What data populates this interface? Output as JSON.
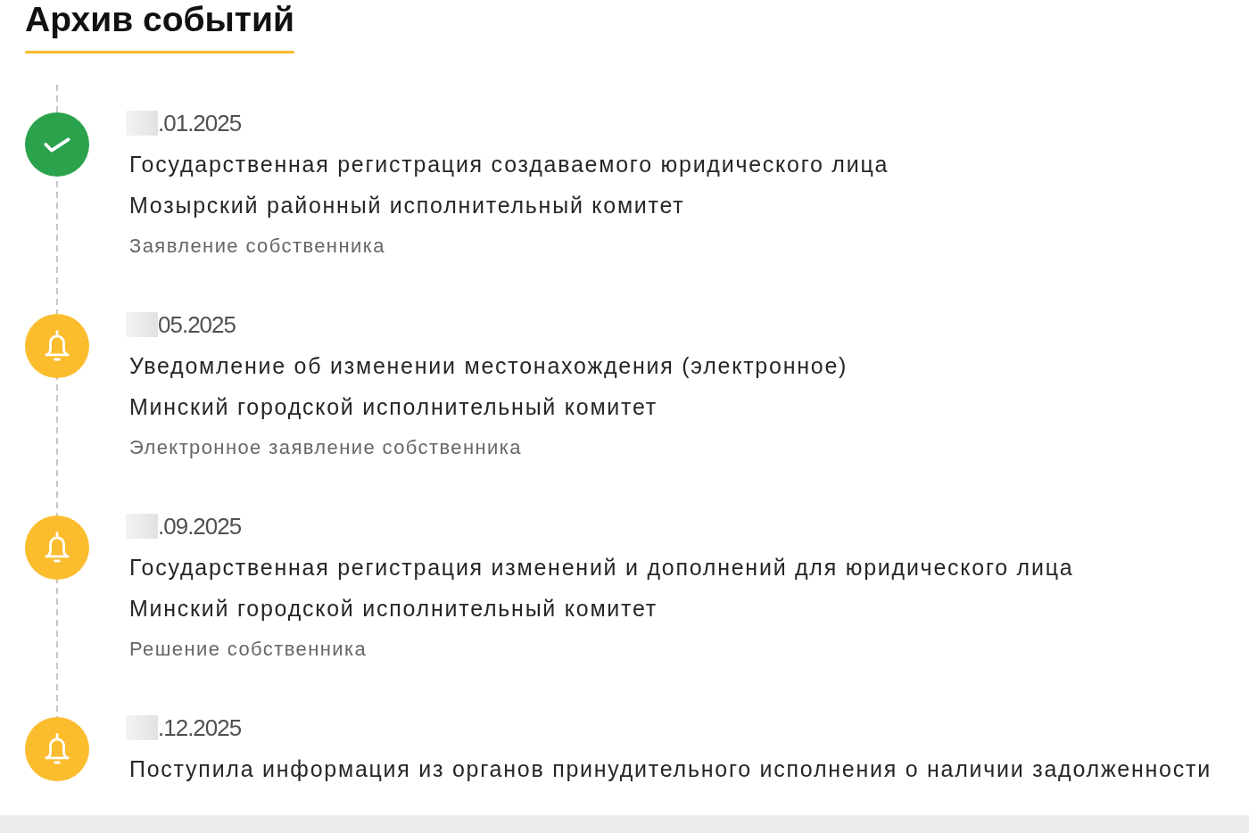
{
  "title": "Архив событий",
  "events": [
    {
      "kind": "completed",
      "date": ".01.2025",
      "title": "Государственная регистрация создаваемого юридического лица",
      "authority": "Мозырский районный исполнительный комитет",
      "basis": "Заявление собственника"
    },
    {
      "kind": "notification",
      "date": "05.2025",
      "title": "Уведомление об изменении местонахождения (электронное)",
      "authority": "Минский городской исполнительный комитет",
      "basis": "Электронное заявление собственника"
    },
    {
      "kind": "notification",
      "date": ".09.2025",
      "title": "Государственная регистрация изменений и дополнений для юридического лица",
      "authority": "Минский городской исполнительный комитет",
      "basis": "Решение собственника"
    },
    {
      "kind": "notification",
      "date": ".12.2025",
      "title": "Поступила информация из органов принудительного исполнения о наличии задолженности"
    }
  ]
}
